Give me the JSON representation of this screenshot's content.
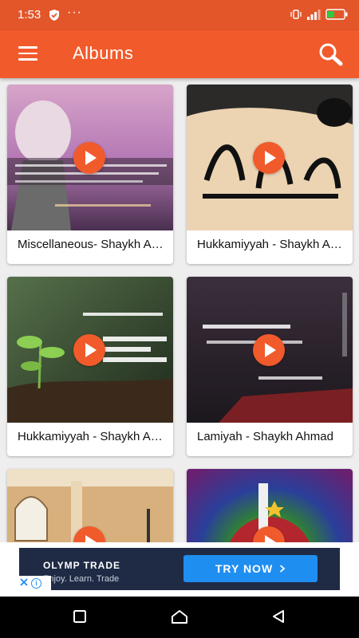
{
  "status_bar": {
    "time": "1:53",
    "overflow_dots": "···",
    "icons": [
      "shield-icon",
      "vibrate-icon",
      "signal-icon",
      "battery-icon"
    ]
  },
  "app_bar": {
    "title": "Albums",
    "menu_icon": "menu-icon",
    "search_icon": "search-icon",
    "color": "#f15a2b"
  },
  "albums": [
    {
      "title": "Miscellaneous- Shaykh Ahmad"
    },
    {
      "title": "Hukkamiyyah - Shaykh Ahmad"
    },
    {
      "title": "Hukkamiyyah - Shaykh Ahmad"
    },
    {
      "title": "Lamiyah - Shaykh Ahmad"
    },
    {
      "title": ""
    },
    {
      "title": ""
    }
  ],
  "ad": {
    "brand": "OLYMP TRADE",
    "tagline": "Enjoy. Learn. Trade",
    "cta": "TRY NOW",
    "cta_color": "#1f8ef1"
  },
  "nav_bar": {
    "icons": [
      "recents-square-icon",
      "home-icon",
      "back-icon"
    ]
  }
}
